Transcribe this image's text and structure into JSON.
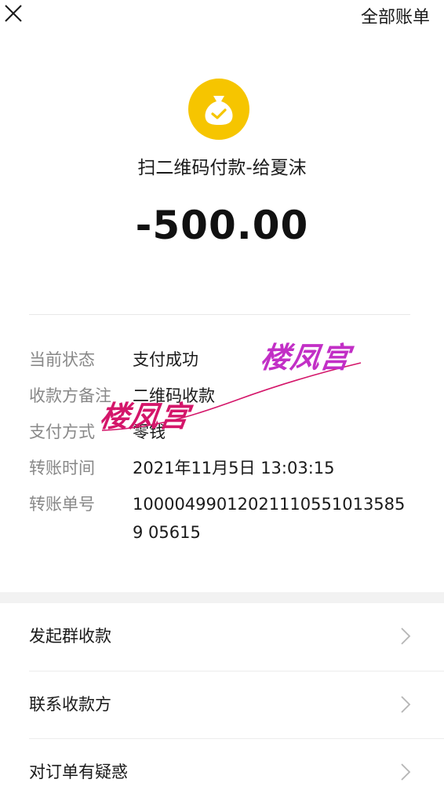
{
  "header": {
    "close_icon": "close-icon",
    "all_bills_label": "全部账单"
  },
  "transaction": {
    "icon": "money-bag-check-icon",
    "icon_color": "#f6c500",
    "title": "扫二维码付款-给夏沫",
    "amount": "-500.00"
  },
  "details": [
    {
      "label": "当前状态",
      "value": "支付成功"
    },
    {
      "label": "收款方备注",
      "value": "二维码收款"
    },
    {
      "label": "支付方式",
      "value": "零钱"
    },
    {
      "label": "转账时间",
      "value": "2021年11月5日 13:03:15"
    },
    {
      "label": "转账单号",
      "value": "100004990120211105510135859 05615"
    }
  ],
  "watermark": {
    "text_1": "楼凤宫",
    "text_2": "楼凤宫"
  },
  "menu": [
    {
      "label": "发起群收款",
      "icon": "chevron-right-icon"
    },
    {
      "label": "联系收款方",
      "icon": "chevron-right-icon"
    },
    {
      "label": "对订单有疑惑",
      "icon": "chevron-right-icon"
    }
  ]
}
